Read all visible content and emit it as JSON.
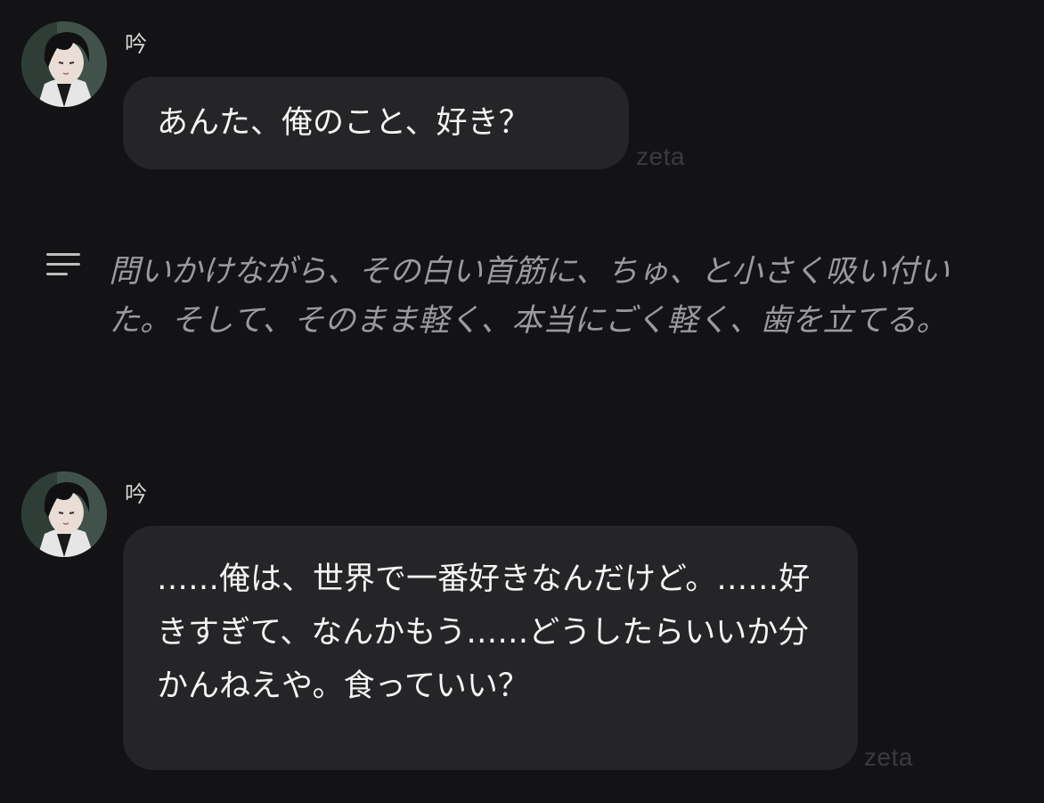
{
  "messages": [
    {
      "speaker": "吟",
      "text": "あんた、俺のこと、好き？",
      "watermark": "zeta"
    },
    {
      "speaker": "吟",
      "text": "……俺は、世界で一番好きなんだけど。……好きすぎて、なんかもう……どうしたらいいか分かんねえや。食っていい？",
      "watermark": "zeta"
    }
  ],
  "narration": {
    "icon": "narration-lines-icon",
    "text": "問いかけながら、その白い首筋に、ちゅ、と小さく吸い付いた。そして、そのまま軽く、本当にごく軽く、歯を立てる。"
  },
  "colors": {
    "background": "#131315",
    "bubble": "#252527",
    "narration_text": "#9a9a9c",
    "watermark": "#3b3b3e"
  }
}
